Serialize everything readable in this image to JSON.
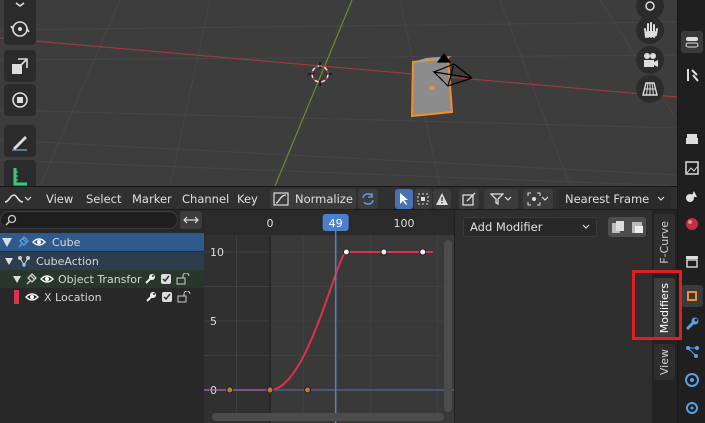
{
  "header": {
    "menus": [
      "View",
      "Select",
      "Marker",
      "Channel",
      "Key"
    ],
    "normalize_label": "Normalize",
    "snap_mode": "Nearest Frame"
  },
  "channels": {
    "search_placeholder": "",
    "rows": [
      {
        "label": "Cube",
        "color": "#f0a030"
      },
      {
        "label": "CubeAction",
        "color": "#d0d0d0"
      },
      {
        "label": "Object Transforms",
        "color": "#d0d0d0"
      },
      {
        "label": "X Location",
        "color": "#f0a030"
      }
    ]
  },
  "graph": {
    "frame_ticks": [
      "0",
      "49",
      "100"
    ],
    "current_frame": "49",
    "value_ticks": [
      "10",
      "5",
      "0"
    ]
  },
  "sidebar": {
    "add_modifier_label": "Add Modifier"
  },
  "tabs": {
    "fcurve": "F-Curve",
    "modifiers": "Modifiers",
    "view": "View"
  },
  "chart_data": {
    "type": "line",
    "x": [
      -30,
      0,
      28,
      57,
      85,
      114
    ],
    "series": [
      {
        "values": [
          0,
          0,
          0,
          10,
          10,
          10
        ]
      }
    ],
    "xlim": [
      -45,
      130
    ],
    "ylim": [
      -0.5,
      11
    ],
    "current_frame": 49
  },
  "colors": {
    "curve": "#e0314b",
    "playhead": "#4d7fcf",
    "highlight": "#e02020",
    "active_bg": "#2f5b8c"
  }
}
